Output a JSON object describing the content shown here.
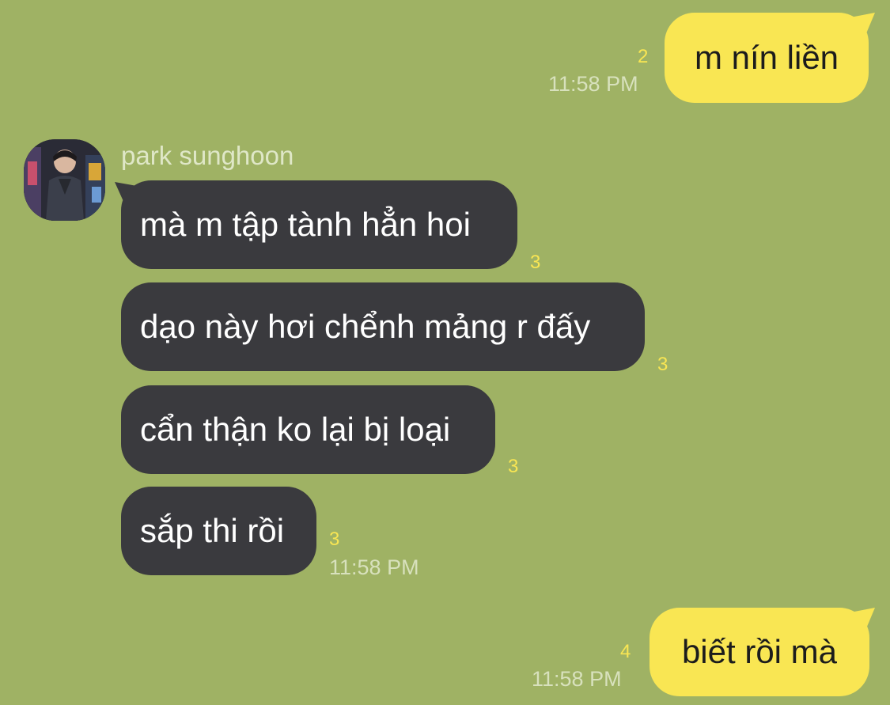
{
  "theme": {
    "background": "#9fb264",
    "sent_bubble": "#f9e653",
    "received_bubble": "#3a3a3e",
    "read_count_color": "#f9e653"
  },
  "messages": {
    "sent_1": {
      "text": "m nín liền",
      "read_count": "2",
      "time": "11:58 PM"
    },
    "received_group": {
      "sender": "park sunghoon",
      "avatar": "profile-photo",
      "items": [
        {
          "text": "mà m tập tành hẳn hoi",
          "read_count": "3"
        },
        {
          "text": "dạo này hơi chểnh mảng r đấy",
          "read_count": "3"
        },
        {
          "text": "cẩn thận ko lại bị loại",
          "read_count": "3"
        },
        {
          "text": "sắp thi rồi",
          "read_count": "3"
        }
      ],
      "time": "11:58 PM"
    },
    "sent_2": {
      "text": "biết rồi mà",
      "read_count": "4",
      "time": "11:58 PM"
    }
  }
}
